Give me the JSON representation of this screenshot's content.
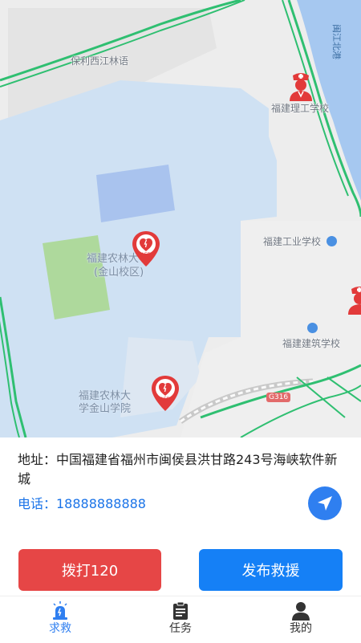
{
  "map": {
    "labels": {
      "poly_xijiang": "保利西江林语",
      "fj_tech_school": "福建理工学校",
      "fj_industry_school": "福建工业学校",
      "fj_construction_school": "福建建筑学校",
      "fafu_jinshan_l1": "福建农林大学",
      "fafu_jinshan_l2": "(金山校区)",
      "fafu_jinshan_college_l1": "福建农林大",
      "fafu_jinshan_college_l2": "学金山学院",
      "river": "闽江北港",
      "road_badge": "G316"
    },
    "aed_text": "AED",
    "colors": {
      "land": "#ededed",
      "campus": "#cfe1f3",
      "building": "#a9c3ee",
      "field": "#aed99c",
      "water": "#a6c8f0",
      "road": "#2fbf71",
      "aed_red": "#e23a3a",
      "doctor_red": "#e23a3a"
    }
  },
  "info": {
    "address": "地址：中国福建省福州市闽侯县洪甘路243号海峡软件新城",
    "phone": "电话：18888888888"
  },
  "buttons": {
    "call": "拨打120",
    "publish": "发布救援"
  },
  "tabs": [
    {
      "label": "求救",
      "icon": "alarm-icon",
      "active": true
    },
    {
      "label": "任务",
      "icon": "clipboard-icon",
      "active": false
    },
    {
      "label": "我的",
      "icon": "user-icon",
      "active": false
    }
  ],
  "accent": "#2f7ff0"
}
